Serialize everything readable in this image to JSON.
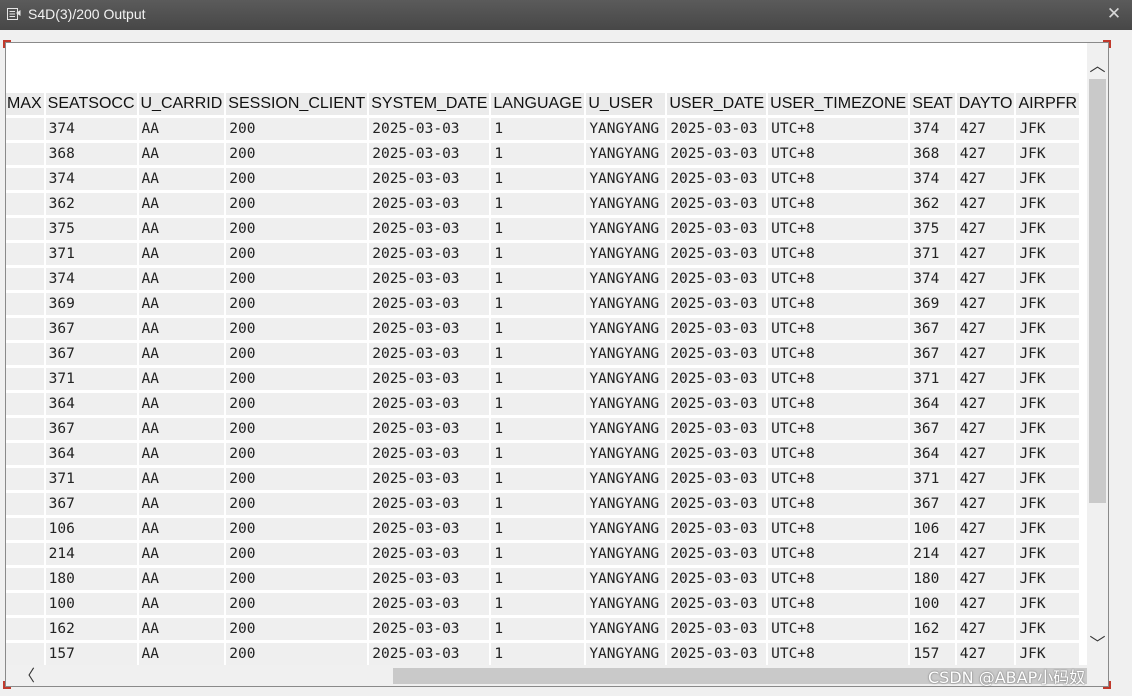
{
  "window": {
    "title": "S4D(3)/200 Output",
    "close_symbol": "✕"
  },
  "grid": {
    "columns": [
      "MAX",
      "SEATSOCC",
      "U_CARRID",
      "SESSION_CLIENT",
      "SYSTEM_DATE",
      "LANGUAGE",
      "U_USER",
      "USER_DATE",
      "USER_TIMEZONE",
      "SEAT",
      "DAYTO",
      "AIRPFR"
    ],
    "rows": [
      [
        "",
        "374",
        "AA",
        "200",
        "2025-03-03",
        "1",
        "YANGYANG",
        "2025-03-03",
        "UTC+8",
        "374",
        "427",
        "JFK"
      ],
      [
        "",
        "368",
        "AA",
        "200",
        "2025-03-03",
        "1",
        "YANGYANG",
        "2025-03-03",
        "UTC+8",
        "368",
        "427",
        "JFK"
      ],
      [
        "",
        "374",
        "AA",
        "200",
        "2025-03-03",
        "1",
        "YANGYANG",
        "2025-03-03",
        "UTC+8",
        "374",
        "427",
        "JFK"
      ],
      [
        "",
        "362",
        "AA",
        "200",
        "2025-03-03",
        "1",
        "YANGYANG",
        "2025-03-03",
        "UTC+8",
        "362",
        "427",
        "JFK"
      ],
      [
        "",
        "375",
        "AA",
        "200",
        "2025-03-03",
        "1",
        "YANGYANG",
        "2025-03-03",
        "UTC+8",
        "375",
        "427",
        "JFK"
      ],
      [
        "",
        "371",
        "AA",
        "200",
        "2025-03-03",
        "1",
        "YANGYANG",
        "2025-03-03",
        "UTC+8",
        "371",
        "427",
        "JFK"
      ],
      [
        "",
        "374",
        "AA",
        "200",
        "2025-03-03",
        "1",
        "YANGYANG",
        "2025-03-03",
        "UTC+8",
        "374",
        "427",
        "JFK"
      ],
      [
        "",
        "369",
        "AA",
        "200",
        "2025-03-03",
        "1",
        "YANGYANG",
        "2025-03-03",
        "UTC+8",
        "369",
        "427",
        "JFK"
      ],
      [
        "",
        "367",
        "AA",
        "200",
        "2025-03-03",
        "1",
        "YANGYANG",
        "2025-03-03",
        "UTC+8",
        "367",
        "427",
        "JFK"
      ],
      [
        "",
        "367",
        "AA",
        "200",
        "2025-03-03",
        "1",
        "YANGYANG",
        "2025-03-03",
        "UTC+8",
        "367",
        "427",
        "JFK"
      ],
      [
        "",
        "371",
        "AA",
        "200",
        "2025-03-03",
        "1",
        "YANGYANG",
        "2025-03-03",
        "UTC+8",
        "371",
        "427",
        "JFK"
      ],
      [
        "",
        "364",
        "AA",
        "200",
        "2025-03-03",
        "1",
        "YANGYANG",
        "2025-03-03",
        "UTC+8",
        "364",
        "427",
        "JFK"
      ],
      [
        "",
        "367",
        "AA",
        "200",
        "2025-03-03",
        "1",
        "YANGYANG",
        "2025-03-03",
        "UTC+8",
        "367",
        "427",
        "JFK"
      ],
      [
        "",
        "364",
        "AA",
        "200",
        "2025-03-03",
        "1",
        "YANGYANG",
        "2025-03-03",
        "UTC+8",
        "364",
        "427",
        "JFK"
      ],
      [
        "",
        "371",
        "AA",
        "200",
        "2025-03-03",
        "1",
        "YANGYANG",
        "2025-03-03",
        "UTC+8",
        "371",
        "427",
        "JFK"
      ],
      [
        "",
        "367",
        "AA",
        "200",
        "2025-03-03",
        "1",
        "YANGYANG",
        "2025-03-03",
        "UTC+8",
        "367",
        "427",
        "JFK"
      ],
      [
        "",
        "106",
        "AA",
        "200",
        "2025-03-03",
        "1",
        "YANGYANG",
        "2025-03-03",
        "UTC+8",
        "106",
        "427",
        "JFK"
      ],
      [
        "",
        "214",
        "AA",
        "200",
        "2025-03-03",
        "1",
        "YANGYANG",
        "2025-03-03",
        "UTC+8",
        "214",
        "427",
        "JFK"
      ],
      [
        "",
        "180",
        "AA",
        "200",
        "2025-03-03",
        "1",
        "YANGYANG",
        "2025-03-03",
        "UTC+8",
        "180",
        "427",
        "JFK"
      ],
      [
        "",
        "100",
        "AA",
        "200",
        "2025-03-03",
        "1",
        "YANGYANG",
        "2025-03-03",
        "UTC+8",
        "100",
        "427",
        "JFK"
      ],
      [
        "",
        "162",
        "AA",
        "200",
        "2025-03-03",
        "1",
        "YANGYANG",
        "2025-03-03",
        "UTC+8",
        "162",
        "427",
        "JFK"
      ],
      [
        "",
        "157",
        "AA",
        "200",
        "2025-03-03",
        "1",
        "YANGYANG",
        "2025-03-03",
        "UTC+8",
        "157",
        "427",
        "JFK"
      ]
    ]
  },
  "scrollbars": {
    "up_symbol": "︿",
    "down_symbol": "﹀",
    "left_symbol": "〈",
    "right_symbol": "〉"
  },
  "watermark": "CSDN @ABAP小码奴"
}
